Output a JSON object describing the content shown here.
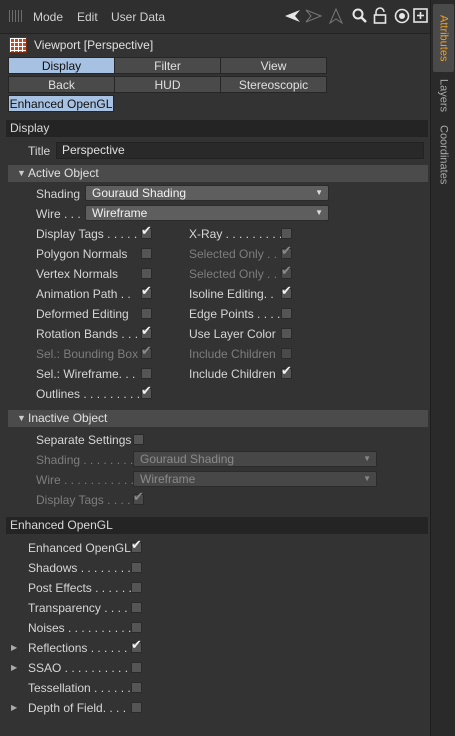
{
  "menubar": {
    "mode": "Mode",
    "edit": "Edit",
    "userdata": "User Data"
  },
  "sidetabs": [
    "Attributes",
    "Layers",
    "Coordinates"
  ],
  "title": "Viewport [Perspective]",
  "tabs": {
    "row1": [
      "Display",
      "Filter",
      "View"
    ],
    "row2": [
      "Back",
      "HUD",
      "Stereoscopic"
    ],
    "row3": [
      "Enhanced OpenGL"
    ],
    "selected": "Display"
  },
  "display_section": {
    "heading": "Display",
    "title_label": "Title",
    "title_value": "Perspective"
  },
  "active_object": {
    "heading": "Active Object",
    "shading_label": "Shading",
    "shading_value": "Gouraud Shading",
    "wire_label": "Wire . . .",
    "wire_value": "Wireframe",
    "left": [
      {
        "label": "Display Tags . . . . .",
        "checked": true,
        "dim": false
      },
      {
        "label": "Polygon Normals",
        "checked": false,
        "dim": false
      },
      {
        "label": "Vertex Normals",
        "checked": false,
        "dim": false
      },
      {
        "label": "Animation Path . .",
        "checked": true,
        "dim": false
      },
      {
        "label": "Deformed Editing",
        "checked": false,
        "dim": false
      },
      {
        "label": "Rotation Bands . . .",
        "checked": true,
        "dim": false
      },
      {
        "label": "Sel.: Bounding Box",
        "checked": true,
        "dim": true
      },
      {
        "label": "Sel.: Wireframe. . .",
        "checked": false,
        "dim": false
      },
      {
        "label": "Outlines . . . . . . . . .",
        "checked": true,
        "dim": false
      }
    ],
    "right": [
      {
        "label": "X-Ray . . . . . . . . .",
        "checked": false,
        "dim": false
      },
      {
        "label": "Selected Only . .",
        "checked": true,
        "dim": true
      },
      {
        "label": "Selected Only . .",
        "checked": true,
        "dim": true
      },
      {
        "label": "Isoline Editing. .",
        "checked": true,
        "dim": false
      },
      {
        "label": "Edge Points . . . . .",
        "checked": false,
        "dim": false
      },
      {
        "label": "Use Layer Color",
        "checked": false,
        "dim": false
      },
      {
        "label": "Include Children",
        "checked": false,
        "dim": true
      },
      {
        "label": "Include Children",
        "checked": true,
        "dim": false
      }
    ]
  },
  "inactive_object": {
    "heading": "Inactive Object",
    "separate_label": "Separate Settings",
    "separate_checked": false,
    "shading_label": "Shading . . . . . . . . .",
    "shading_value": "Gouraud Shading",
    "wire_label": "Wire . . . . . . . . . . . .",
    "wire_value": "Wireframe",
    "tags_label": "Display Tags . . . . .",
    "tags_checked": true
  },
  "enhanced": {
    "heading": "Enhanced OpenGL",
    "items": [
      {
        "label": "Enhanced OpenGL",
        "checked": true,
        "expand": false
      },
      {
        "label": "Shadows . . . . . . . . .",
        "checked": false,
        "expand": false
      },
      {
        "label": "Post Effects . . . . . . .",
        "checked": false,
        "expand": false
      },
      {
        "label": "Transparency . . . .",
        "checked": false,
        "expand": false
      },
      {
        "label": "Noises . . . . . . . . . . .",
        "checked": false,
        "expand": false
      },
      {
        "label": "Reflections . . . . . . .",
        "checked": true,
        "expand": true
      },
      {
        "label": "SSAO . . . . . . . . . . . .",
        "checked": false,
        "expand": true
      },
      {
        "label": "Tessellation . . . . . . .",
        "checked": false,
        "expand": false
      },
      {
        "label": "Depth of Field. . . .",
        "checked": false,
        "expand": true
      }
    ]
  }
}
